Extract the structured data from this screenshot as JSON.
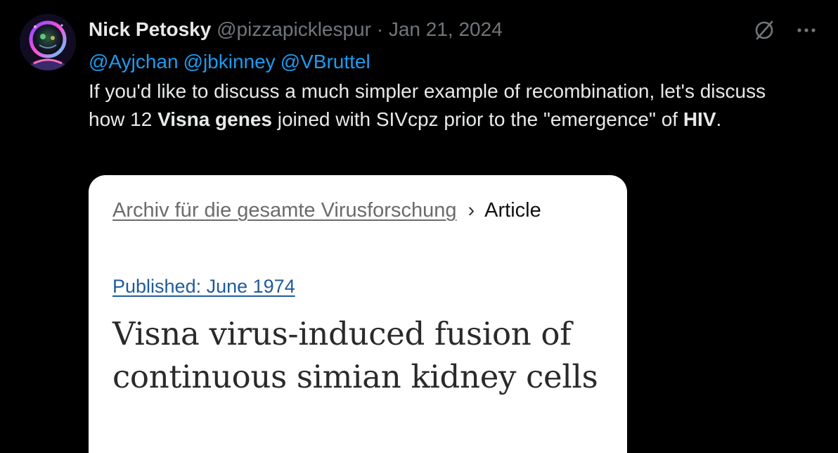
{
  "tweet": {
    "author": {
      "display_name": "Nick Petosky",
      "handle": "@pizzapicklespur",
      "separator": "·",
      "date": "Jan 21, 2024",
      "avatar_icon": "astronaut-helmet-avatar"
    },
    "mentions": [
      "@Ayjchan",
      "@jbkinney",
      "@VBruttel"
    ],
    "body": {
      "part1": "If you'd like to discuss a much simpler example of recombination, let's discuss how 12 ",
      "bold1": "Visna genes",
      "part2": " joined with SIVcpz prior to the \"emergence\" of ",
      "bold2": "HIV",
      "part3": "."
    },
    "icons": {
      "hide": "hide-slash-circle-icon",
      "more": "more-dots-icon"
    },
    "colors": {
      "background": "#000000",
      "text": "#e7e9ea",
      "muted": "#71767b",
      "mention": "#1d9bf0"
    }
  },
  "card": {
    "breadcrumb": {
      "journal": "Archiv für die gesamte Virusforschung",
      "separator": "›",
      "current": "Article"
    },
    "published": "Published: June 1974",
    "title": "Visna virus-induced fusion of continuous simian kidney cells",
    "colors": {
      "background": "#ffffff",
      "published_link": "#1f5c99",
      "title": "#2a2a2a"
    }
  }
}
